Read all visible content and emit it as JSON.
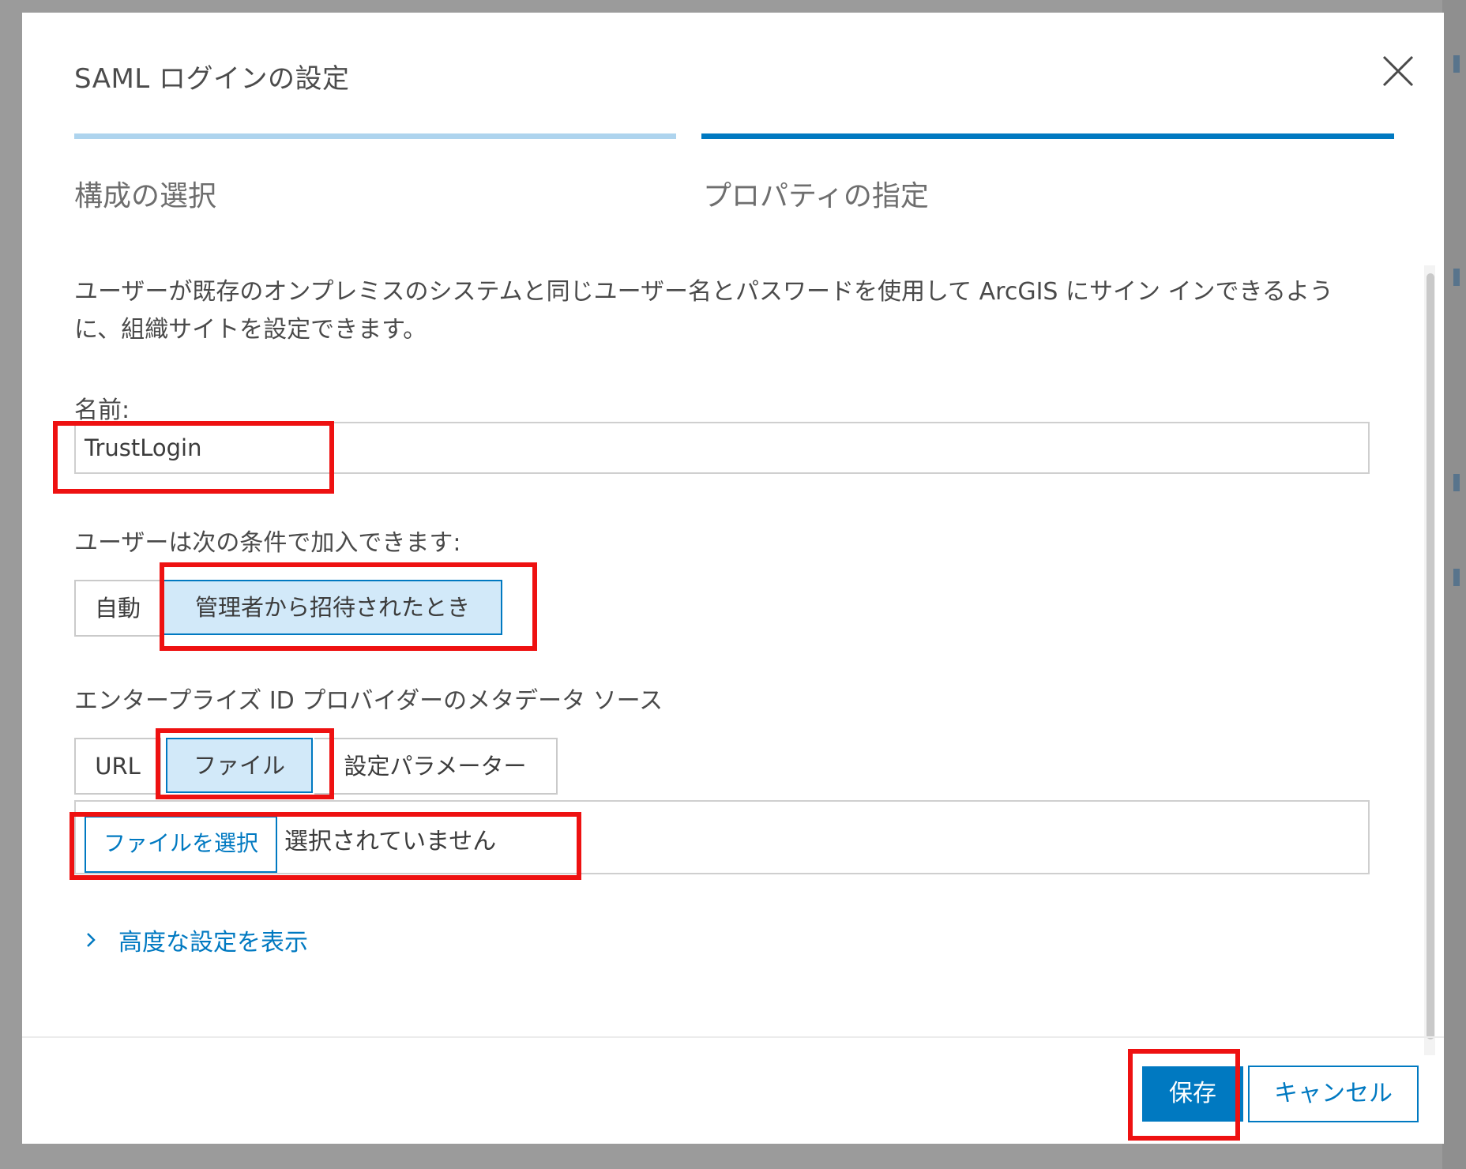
{
  "dialog": {
    "title": "SAML ログインの設定",
    "close_icon": "close-icon"
  },
  "steps": [
    {
      "label": "構成の選択",
      "state": "completed"
    },
    {
      "label": "プロパティの指定",
      "state": "current"
    }
  ],
  "description": "ユーザーが既存のオンプレミスのシステムと同じユーザー名とパスワードを使用して ArcGIS にサイン インできるように、組織サイトを設定できます。",
  "name_field": {
    "label": "名前:",
    "value": "TrustLogin"
  },
  "join_option": {
    "label": "ユーザーは次の条件で加入できます:",
    "options": [
      "自動",
      "管理者から招待されたとき"
    ],
    "selected": "管理者から招待されたとき"
  },
  "metadata_source": {
    "label": "エンタープライズ ID プロバイダーのメタデータ ソース",
    "options": [
      "URL",
      "ファイル",
      "設定パラメーター"
    ],
    "selected": "ファイル"
  },
  "file_picker": {
    "button_label": "ファイルを選択",
    "status": "選択されていません"
  },
  "advanced_link": {
    "label": "高度な設定を表示",
    "icon": "chevron-right-icon"
  },
  "footer": {
    "save_label": "保存",
    "cancel_label": "キャンセル"
  },
  "colors": {
    "accent": "#0079c1",
    "selected_bg": "#d2e9f9",
    "step_completed": "#aed4ee",
    "highlight": "#ee1111"
  }
}
